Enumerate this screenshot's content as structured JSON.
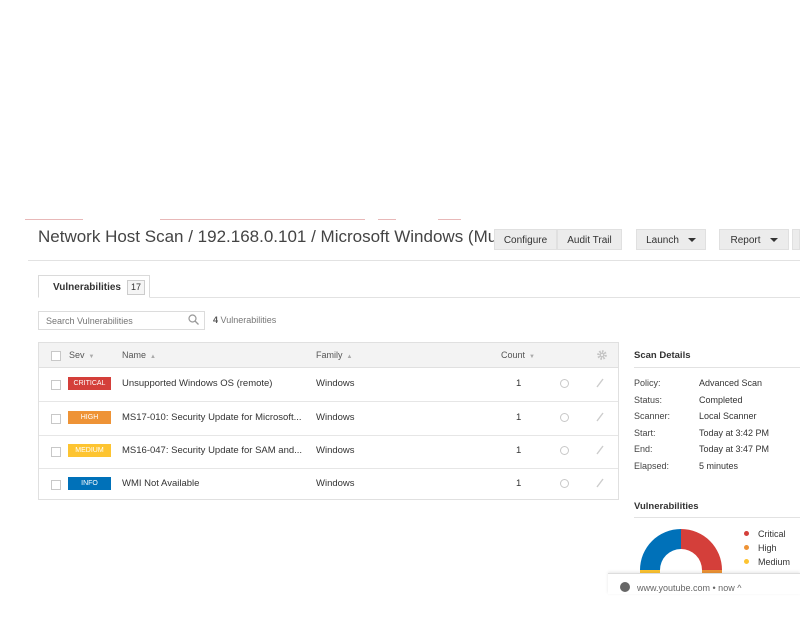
{
  "header": {
    "title": "Network Host Scan / 192.168.0.101 / Microsoft Windows (Mu...",
    "buttons": {
      "configure": "Configure",
      "audit_trail": "Audit Trail",
      "launch": "Launch",
      "report": "Report"
    }
  },
  "tabs": {
    "vulnerabilities_label": "Vulnerabilities",
    "vulnerabilities_count": "17"
  },
  "search": {
    "placeholder": "Search Vulnerabilities",
    "result_count": "4",
    "result_label": "Vulnerabilities"
  },
  "table": {
    "columns": {
      "sev": "Sev",
      "name": "Name",
      "family": "Family",
      "count": "Count"
    },
    "rows": [
      {
        "severity": "CRITICAL",
        "severity_color": "#d43f3a",
        "name": "Unsupported Windows OS (remote)",
        "family": "Windows",
        "count": "1"
      },
      {
        "severity": "HIGH",
        "severity_color": "#ee9336",
        "name": "MS17-010: Security Update for Microsoft...",
        "family": "Windows",
        "count": "1"
      },
      {
        "severity": "MEDIUM",
        "severity_color": "#fdc431",
        "name": "MS16-047: Security Update for SAM and...",
        "family": "Windows",
        "count": "1"
      },
      {
        "severity": "INFO",
        "severity_color": "#0071b9",
        "name": "WMI Not Available",
        "family": "Windows",
        "count": "1"
      }
    ]
  },
  "scan_details": {
    "title": "Scan Details",
    "items": [
      {
        "key": "Policy:",
        "value": "Advanced Scan"
      },
      {
        "key": "Status:",
        "value": "Completed"
      },
      {
        "key": "Scanner:",
        "value": "Local Scanner"
      },
      {
        "key": "Start:",
        "value": "Today at 3:42 PM"
      },
      {
        "key": "End:",
        "value": "Today at 3:47 PM"
      },
      {
        "key": "Elapsed:",
        "value": "5 minutes"
      }
    ]
  },
  "vuln_chart": {
    "title": "Vulnerabilities",
    "legend": [
      {
        "label": "Critical",
        "color": "#d43f3a"
      },
      {
        "label": "High",
        "color": "#ee9336"
      },
      {
        "label": "Medium",
        "color": "#fdc431"
      }
    ]
  },
  "notification": {
    "text": "www.youtube.com • now ^"
  },
  "colors": {
    "critical": "#d43f3a",
    "high": "#ee9336",
    "medium": "#fdc431",
    "info": "#0071b9"
  },
  "icons": [
    "search-icon",
    "gear-icon",
    "check-circle-icon",
    "pencil-icon",
    "caret-down-icon",
    "notification-icon"
  ]
}
